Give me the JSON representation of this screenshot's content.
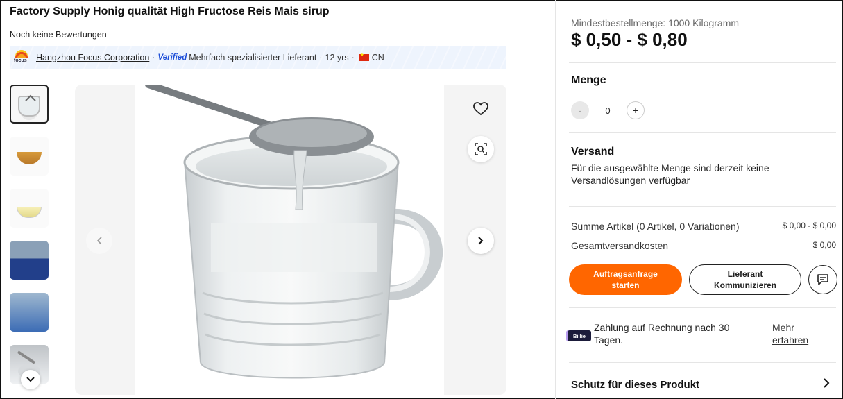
{
  "product": {
    "title": "Factory Supply Honig qualität High Fructose Reis Mais sirup",
    "reviews": "Noch keine Bewertungen"
  },
  "supplier": {
    "logo_text": "focus",
    "name": "Hangzhou Focus Corporation",
    "separator": "·",
    "verified": "Verified",
    "type": "Mehrfach spezialisierter Lieferant",
    "years": "12 yrs",
    "country": "CN"
  },
  "gallery": {
    "thumbnails": [
      "thumb-cup",
      "thumb-bowl-amber",
      "thumb-bowl-clear",
      "thumb-barrels",
      "thumb-drums",
      "thumb-spoon"
    ],
    "icons": {
      "favorite": "heart-icon",
      "zoom": "image-search-icon",
      "prev": "chevron-left-icon",
      "next": "chevron-right-icon",
      "more": "chevron-down-icon"
    }
  },
  "pricing": {
    "moq": "Mindestbestellmenge: 1000 Kilogramm",
    "price_range": "$ 0,50 - $ 0,80"
  },
  "quantity": {
    "label": "Menge",
    "minus": "-",
    "value": "0",
    "plus": "+"
  },
  "shipping": {
    "label": "Versand",
    "text": "Für die ausgewählte Menge sind derzeit keine Versandlösungen verfügbar"
  },
  "summary": {
    "items_label": "Summe Artikel (0 Artikel, 0 Variationen)",
    "items_value": "$ 0,00 - $ 0,00",
    "shipping_label": "Gesamtversandkosten",
    "shipping_value": "$ 0,00"
  },
  "actions": {
    "order": "Auftragsanfrage starten",
    "contact": "Lieferant Kommunizieren"
  },
  "payment": {
    "logo": "Billie",
    "text": "Zahlung auf Rechnung nach 30 Tagen.",
    "link": "Mehr erfahren"
  },
  "protection": {
    "label": "Schutz für dieses Produkt"
  },
  "colors": {
    "accent": "#ff6600",
    "verified": "#1f4fd8"
  }
}
